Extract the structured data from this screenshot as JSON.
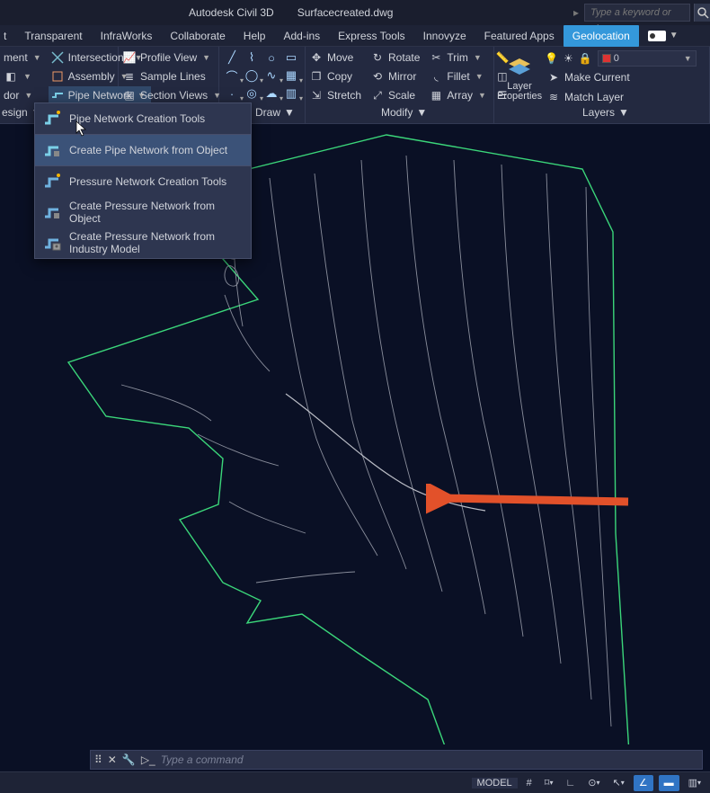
{
  "titlebar": {
    "app_name": "Autodesk Civil 3D",
    "file_name": "Surfacecreated.dwg",
    "search_placeholder": "Type a keyword or phrase"
  },
  "menubar": {
    "tabs": [
      "t",
      "Transparent",
      "InfraWorks",
      "Collaborate",
      "Help",
      "Add-ins",
      "Express Tools",
      "Innovyze",
      "Featured Apps",
      "Geolocation"
    ],
    "active_index": 9
  },
  "ribbon": {
    "design": {
      "items": [
        "ment",
        "dor"
      ],
      "intersections": "Intersections",
      "assembly": "Assembly",
      "pipe_network": "Pipe Network",
      "title": "esign"
    },
    "profiles": {
      "profile_view": "Profile View",
      "sample_lines": "Sample Lines",
      "section_views": "Section Views"
    },
    "draw_title": "Draw",
    "modify": {
      "move": "Move",
      "copy": "Copy",
      "stretch": "Stretch",
      "rotate": "Rotate",
      "mirror": "Mirror",
      "scale": "Scale",
      "trim": "Trim",
      "fillet": "Fillet",
      "array": "Array",
      "title": "Modify"
    },
    "layers": {
      "layer_props": "Layer\nProperties",
      "make_current": "Make Current",
      "match_layer": "Match Layer",
      "current_layer": "0",
      "title": "Layers"
    }
  },
  "dropdown": {
    "items": [
      "Pipe Network Creation Tools",
      "Create Pipe Network from Object",
      "Pressure Network Creation Tools",
      "Create Pressure Network from Object",
      "Create Pressure Network from Industry Model"
    ],
    "hover_index": 1
  },
  "commandline": {
    "placeholder": "Type a command"
  },
  "statusbar": {
    "model": "MODEL"
  }
}
